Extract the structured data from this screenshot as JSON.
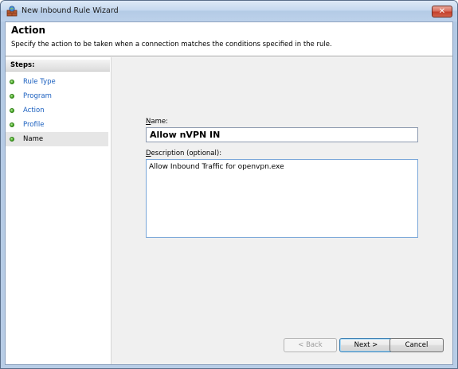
{
  "window": {
    "title": "New Inbound Rule Wizard",
    "close_glyph": "✕"
  },
  "header": {
    "title": "Action",
    "description": "Specify the action to be taken when a connection matches the conditions specified in the rule."
  },
  "sidebar": {
    "steps_label": "Steps:",
    "items": [
      {
        "label": "Rule Type",
        "state": "link"
      },
      {
        "label": "Program",
        "state": "link"
      },
      {
        "label": "Action",
        "state": "link"
      },
      {
        "label": "Profile",
        "state": "link"
      },
      {
        "label": "Name",
        "state": "current"
      }
    ]
  },
  "form": {
    "name_label_accel": "N",
    "name_label_rest": "ame:",
    "name_value": "Allow nVPN IN",
    "description_label_accel": "D",
    "description_label_rest": "escription (optional):",
    "description_value": "Allow Inbound Traffic for openvpn.exe"
  },
  "buttons": {
    "back": "< Back",
    "next": "Next >",
    "cancel": "Cancel"
  },
  "colors": {
    "link": "#1a5fbf",
    "step_dot": "#3b9c1b"
  },
  "icons": {
    "title_icon": "firewall-icon",
    "step_icon": "green-dot-icon"
  }
}
